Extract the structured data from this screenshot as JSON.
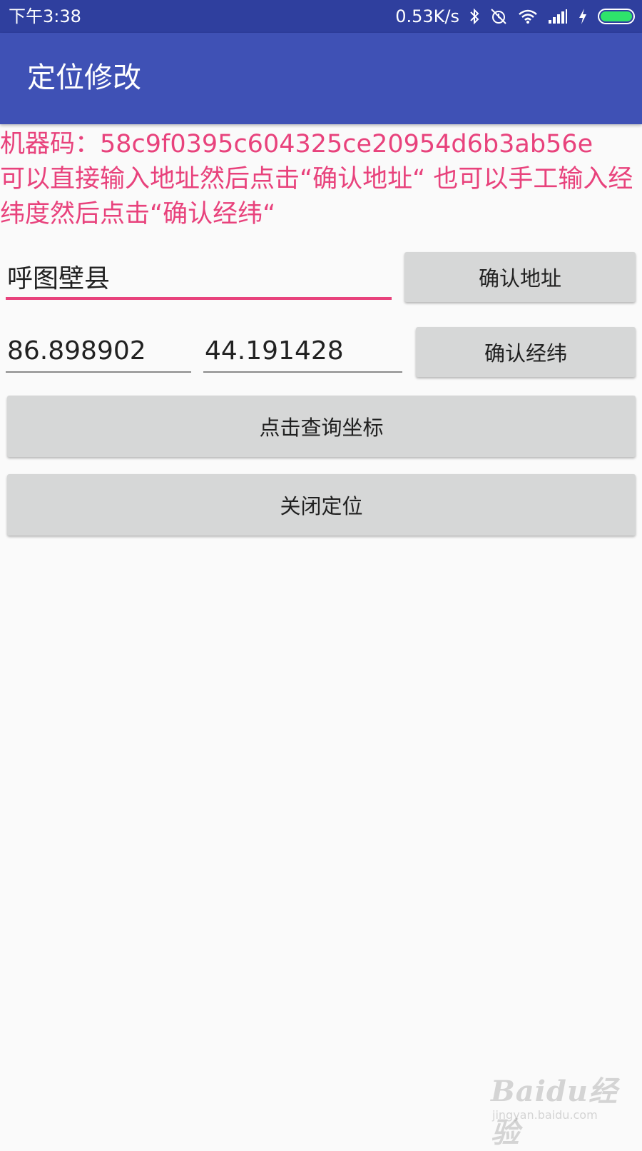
{
  "status_bar": {
    "time": "下午3:38",
    "network_speed": "0.53K/s",
    "icons": [
      "bluetooth-icon",
      "alarm-off-icon",
      "wifi-icon",
      "signal-icon",
      "charging-icon",
      "battery-icon"
    ],
    "battery_level": 1.0
  },
  "app_bar": {
    "title": "定位修改"
  },
  "info": {
    "machine_code": "机器码：58c9f0395c604325ce20954d6b3ab56e",
    "instructions": "可以直接输入地址然后点击“确认地址“ 也可以手工输入经纬度然后点击“确认经纬“"
  },
  "form": {
    "address_value": "呼图壁县",
    "longitude_value": "86.898902",
    "latitude_value": "44.191428",
    "confirm_address_label": "确认地址",
    "confirm_coords_label": "确认经纬",
    "query_coords_label": "点击查询坐标",
    "close_location_label": "关闭定位"
  },
  "watermark": {
    "logo": "Baidu经验",
    "url": "jingyan.baidu.com"
  },
  "colors": {
    "status_bar": "#2f3f9e",
    "app_bar": "#3f51b5",
    "accent": "#e8427c",
    "button": "#d6d7d7",
    "background": "#fafafa"
  }
}
